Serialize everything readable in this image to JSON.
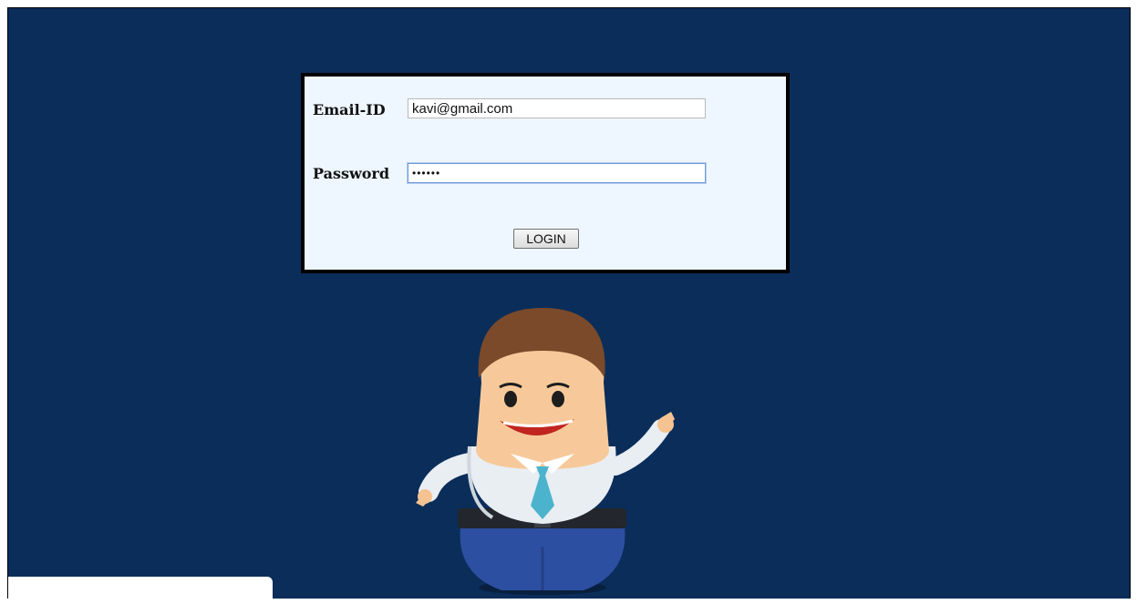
{
  "login_form": {
    "email_label": "Email-ID",
    "email_value": "kavi@gmail.com",
    "password_label": "Password",
    "password_value": "••••••",
    "login_button_label": "LOGIN"
  },
  "colors": {
    "page_background": "#0b2d5a",
    "panel_background": "#eef6ff",
    "panel_border": "#000000"
  },
  "illustration": {
    "icon": "waving-man-mascot-icon"
  }
}
